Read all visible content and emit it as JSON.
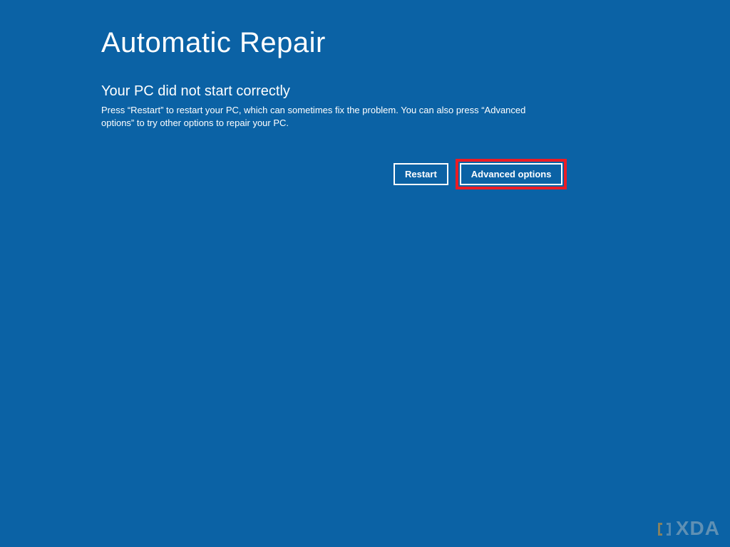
{
  "header": {
    "title": "Automatic Repair"
  },
  "main": {
    "subtitle": "Your PC did not start correctly",
    "body": "Press “Restart” to restart your PC, which can sometimes fix the problem. You can also press “Advanced options” to try other options to repair your PC."
  },
  "buttons": {
    "restart_label": "Restart",
    "advanced_label": "Advanced options"
  },
  "annotation": {
    "highlight_target": "advanced-options-button",
    "highlight_color": "#ec1c24"
  },
  "watermark": {
    "text": "XDA"
  },
  "colors": {
    "background": "#0b62a5",
    "text": "#ffffff",
    "button_border": "#ffffff"
  }
}
